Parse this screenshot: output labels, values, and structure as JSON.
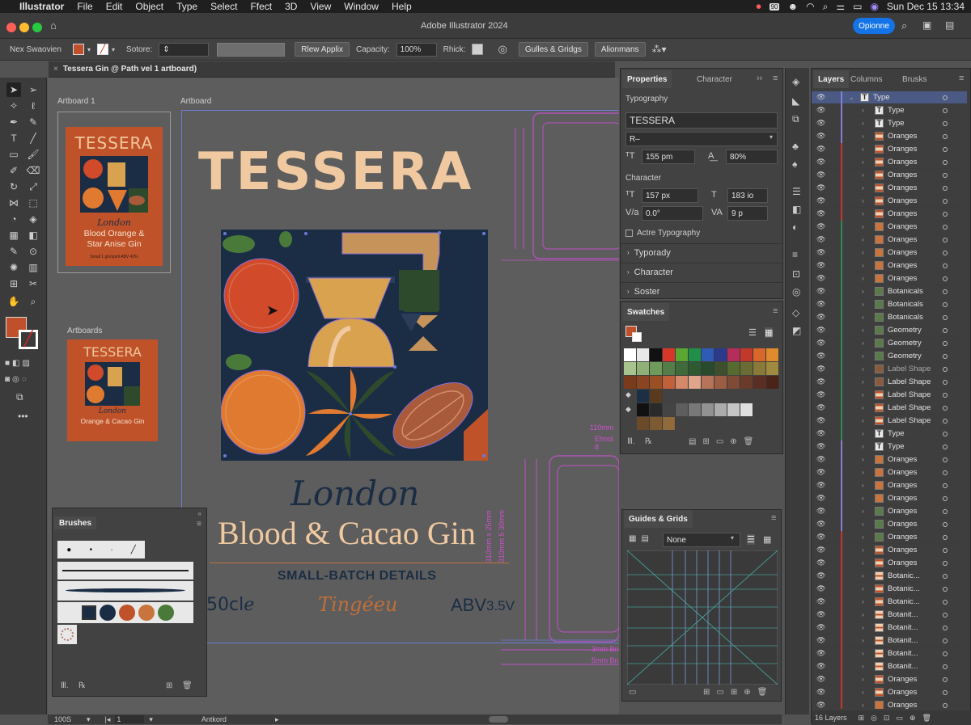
{
  "menubar": {
    "app": "Illustrator",
    "items": [
      "File",
      "Edit",
      "Object",
      "Type",
      "Select",
      "Ffect",
      "3D",
      "View",
      "Window",
      "Help"
    ],
    "badge": "90",
    "datetime": "Sun Dec 15  13:34"
  },
  "window": {
    "title": "Adobe Illustrator 2024",
    "share_label": "Opionne"
  },
  "controlbar": {
    "selection_label": "Nex Swaovien",
    "stroke_label": "Sotore:",
    "apply_label": "Rlew Applix",
    "opacity_label": "Capacity:",
    "opacity_value": "100%",
    "rhick_label": "Rhick:",
    "guides_label": "Gulles & Gridgs",
    "align_label": "Alionmans"
  },
  "document": {
    "tab_title": "Tessera Gin @ Path vel 1 artboard)"
  },
  "canvas": {
    "artboard1_label": "Artboard 1",
    "artboard_label": "Artboard",
    "artboards_label": "Artboards",
    "thumb1": {
      "brand": "TESSERA",
      "city": "London",
      "name1": "Blood Orange &",
      "name2": "Star Anise Gin",
      "small": "Small 1 gin/spirit  ABV 43%",
      "size": "50cl e"
    },
    "thumb2": {
      "brand": "TESSERA",
      "city": "London",
      "name1": "Orange & Cacao Gin"
    },
    "main": {
      "brand": "TESSERA",
      "city": "London",
      "product": "Blood & Cacao Gin",
      "subtitle": "SMALL-BATCH DETAILS",
      "volume": "50clℯ",
      "signature": "Tingéeu",
      "abv": "ABV",
      "abv_value": "3.5V"
    },
    "dimensions": {
      "d1": "110mm",
      "d2": "Ehnol 8",
      "d3": "310mm x 25mm",
      "d4": "310mm 5 30mm",
      "d5": "3mm Bn",
      "d6": "5mm Bn"
    }
  },
  "properties": {
    "tab1": "Properties",
    "tab2": "Character",
    "section_typography": "Typography",
    "font_name": "TESSERA",
    "font_style": "R–",
    "size_value": "155 pm",
    "scale_value": "80%",
    "section_character": "Character",
    "kern_value": "157 px",
    "tracking_value": "183 io",
    "baseline_value": "0.0°",
    "rotate_value": "9 p",
    "active_typography": "Actre Typography",
    "expand1": "Typorady",
    "expand2": "Character",
    "expand3": "Soster"
  },
  "swatches": {
    "title": "Swatches",
    "row1": [
      "#ffffff",
      "#e8e8e8",
      "#111111",
      "#d9362a",
      "#5aa832",
      "#1f8f4a",
      "#2d5bb5",
      "#2b3a8c",
      "#b52d5a",
      "#c2382b",
      "#d9662a",
      "#e08a2e"
    ],
    "row2": [
      "#a7c48d",
      "#8fb077",
      "#6e9a5a",
      "#557d48",
      "#3f6a3a",
      "#2e5a32",
      "#2a4a2e",
      "#3d4f2c",
      "#556b2f",
      "#6b6b35",
      "#8a7a3a",
      "#a08a40"
    ],
    "row3": [
      "#7a3a1c",
      "#8a4520",
      "#9c4e24",
      "#c2603a",
      "#d48a6a",
      "#e0a58a",
      "#b7745a",
      "#9b5e44",
      "#7f4a36",
      "#6a3a2a",
      "#5a2e22",
      "#4a2418"
    ],
    "row4": [
      "#1c2f45",
      "#5a3a1e"
    ],
    "row5": [
      "#111111",
      "#2a2a2a",
      "#444444",
      "#5e5e5e",
      "#787878",
      "#929292",
      "#acacac",
      "#c6c6c6",
      "#e0e0e0"
    ],
    "row6": [
      "#6b4a2a",
      "#7d5a32",
      "#8f6a3a"
    ]
  },
  "guides": {
    "title": "Guides & Grids",
    "dropdown": "None"
  },
  "brushes": {
    "title": "Brushes"
  },
  "layers": {
    "tabs": [
      "Layers",
      "Columns",
      "Brusks"
    ],
    "count": "16 Layers",
    "rows": [
      {
        "name": "Type",
        "sel": true,
        "top": true,
        "thumb": "T",
        "color": "#8a7cd6"
      },
      {
        "name": "Type",
        "thumb": "T",
        "color": "#8a7cd6"
      },
      {
        "name": "Type",
        "thumb": "T",
        "color": "#8a7cd6"
      },
      {
        "name": "Oranges",
        "thumb": "l",
        "color": "#8a7cd6"
      },
      {
        "name": "Oranges",
        "thumb": "l",
        "color": "#c0392b"
      },
      {
        "name": "Oranges",
        "thumb": "l",
        "color": "#c0392b"
      },
      {
        "name": "Oranges",
        "thumb": "l",
        "color": "#c0392b"
      },
      {
        "name": "Oranges",
        "thumb": "l",
        "color": "#c0392b"
      },
      {
        "name": "Oranges",
        "thumb": "l",
        "color": "#c0392b"
      },
      {
        "name": "Oranges",
        "thumb": "l",
        "color": "#c0392b"
      },
      {
        "name": "Oranges",
        "thumb": "o",
        "color": "#2e8b57"
      },
      {
        "name": "Oranges",
        "thumb": "o",
        "color": "#2e8b57"
      },
      {
        "name": "Oranges",
        "thumb": "o",
        "color": "#2e8b57"
      },
      {
        "name": "Oranges",
        "thumb": "o",
        "color": "#2e8b57"
      },
      {
        "name": "Oranges",
        "thumb": "o",
        "color": "#2e8b57"
      },
      {
        "name": "Botanicals",
        "thumb": "g",
        "color": "#2e8b57"
      },
      {
        "name": "Botanicals",
        "thumb": "g",
        "color": "#2e8b57"
      },
      {
        "name": "Botanicals",
        "thumb": "g",
        "color": "#2e8b57"
      },
      {
        "name": "Geometry",
        "thumb": "g",
        "color": "#2e8b57"
      },
      {
        "name": "Geometry",
        "thumb": "g",
        "color": "#2e8b57"
      },
      {
        "name": "Geometry",
        "thumb": "g",
        "color": "#2e8b57"
      },
      {
        "name": "Label Shape",
        "thumb": "b",
        "color": "#2e8b57",
        "dim": true
      },
      {
        "name": "Label Shape",
        "thumb": "b",
        "color": "#2e8b57"
      },
      {
        "name": "Label Shape",
        "thumb": "l",
        "color": "#2e8b57"
      },
      {
        "name": "Label Shape",
        "thumb": "l",
        "color": "#2e8b57"
      },
      {
        "name": "Label Shape",
        "thumb": "l",
        "color": "#2e8b57"
      },
      {
        "name": "Type",
        "thumb": "T",
        "color": "#2e8b57"
      },
      {
        "name": "Type",
        "thumb": "T",
        "color": "#8a7cd6"
      },
      {
        "name": "Oranges",
        "thumb": "o",
        "color": "#8a7cd6"
      },
      {
        "name": "Oranges",
        "thumb": "o",
        "color": "#8a7cd6"
      },
      {
        "name": "Oranges",
        "thumb": "o",
        "color": "#8a7cd6"
      },
      {
        "name": "Oranges",
        "thumb": "o",
        "color": "#8a7cd6"
      },
      {
        "name": "Oranges",
        "thumb": "g",
        "color": "#8a7cd6"
      },
      {
        "name": "Oranges",
        "thumb": "g",
        "color": "#8a7cd6"
      },
      {
        "name": "Oranges",
        "thumb": "g",
        "color": "#c0392b"
      },
      {
        "name": "Oranges",
        "thumb": "l",
        "color": "#c0392b"
      },
      {
        "name": "Oranges",
        "thumb": "l",
        "color": "#c0392b"
      },
      {
        "name": "Botanic...",
        "thumb": "r",
        "color": "#c0392b"
      },
      {
        "name": "Botanic...",
        "thumb": "l",
        "color": "#c0392b"
      },
      {
        "name": "Botanic...",
        "thumb": "l",
        "color": "#c0392b"
      },
      {
        "name": "Botanit...",
        "thumb": "r",
        "color": "#c0392b"
      },
      {
        "name": "Botanit...",
        "thumb": "r",
        "color": "#c0392b"
      },
      {
        "name": "Botanit...",
        "thumb": "r",
        "color": "#c0392b"
      },
      {
        "name": "Botanit...",
        "thumb": "r",
        "color": "#c0392b"
      },
      {
        "name": "Botanit...",
        "thumb": "r",
        "color": "#c0392b"
      },
      {
        "name": "Oranges",
        "thumb": "l",
        "color": "#c0392b"
      },
      {
        "name": "Oranges",
        "thumb": "l",
        "color": "#c0392b"
      },
      {
        "name": "Oranges",
        "thumb": "o",
        "color": "#c0392b"
      }
    ]
  },
  "statusbar": {
    "zoom": "100S",
    "page": "1",
    "artboard_name": "Antkord"
  }
}
